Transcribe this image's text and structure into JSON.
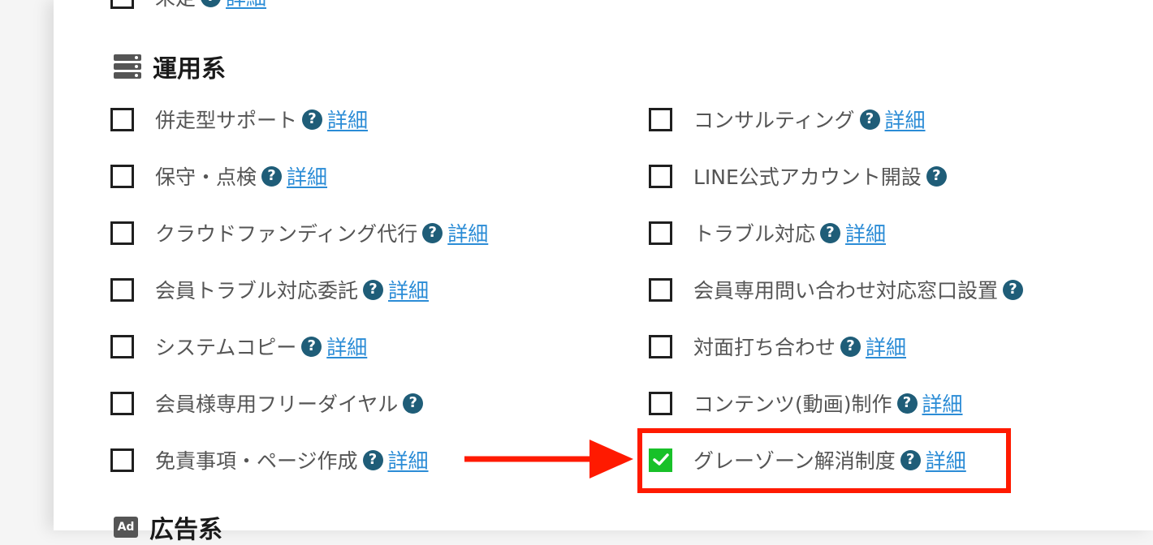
{
  "top_partial": {
    "label": "未定",
    "link": "詳細"
  },
  "sections": {
    "operations": {
      "title": "運用系",
      "icon": "server-icon"
    },
    "advertising": {
      "title": "広告系",
      "icon": "ad-icon"
    }
  },
  "help_glyph": "?",
  "left_items": [
    {
      "label": "併走型サポート",
      "link": "詳細",
      "checked": false
    },
    {
      "label": "保守・点検",
      "link": "詳細",
      "checked": false
    },
    {
      "label": "クラウドファンディング代行",
      "link": "詳細",
      "checked": false
    },
    {
      "label": "会員トラブル対応委託",
      "link": "詳細",
      "checked": false
    },
    {
      "label": "システムコピー",
      "link": "詳細",
      "checked": false
    },
    {
      "label": "会員様専用フリーダイヤル",
      "link": "",
      "checked": false
    },
    {
      "label": "免責事項・ページ作成",
      "link": "詳細",
      "checked": false
    }
  ],
  "right_items": [
    {
      "label": "コンサルティング",
      "link": "詳細",
      "checked": false
    },
    {
      "label": "LINE公式アカウント開設",
      "link": "",
      "checked": false
    },
    {
      "label": "トラブル対応",
      "link": "詳細",
      "checked": false
    },
    {
      "label": "会員専用問い合わせ対応窓口設置",
      "link": "",
      "checked": false
    },
    {
      "label": "対面打ち合わせ",
      "link": "詳細",
      "checked": false
    },
    {
      "label": "コンテンツ(動画)制作",
      "link": "詳細",
      "checked": false
    },
    {
      "label": "グレーゾーン解消制度",
      "link": "詳細",
      "checked": true
    }
  ],
  "colors": {
    "highlight": "#ff1a00",
    "checked": "#18c129",
    "help_icon": "#1f5d78",
    "link": "#2b8cd6"
  }
}
